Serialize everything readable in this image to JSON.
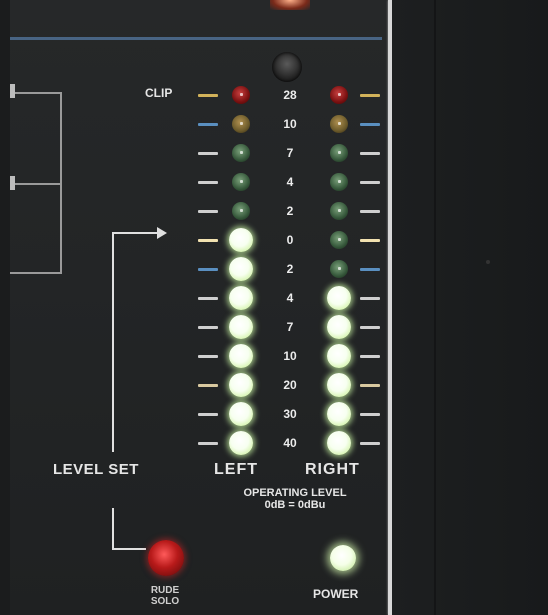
{
  "meter": {
    "clip_label": "CLIP",
    "scale": [
      "28",
      "10",
      "7",
      "4",
      "2",
      "0",
      "2",
      "4",
      "7",
      "10",
      "20",
      "30",
      "40"
    ],
    "left_leds": [
      "red-off",
      "amber-off",
      "green-off",
      "green-off",
      "green-off",
      "on",
      "on",
      "on",
      "on",
      "on",
      "on",
      "on",
      "on"
    ],
    "right_leds": [
      "red-off",
      "amber-off",
      "green-off",
      "green-off",
      "green-off",
      "green-off",
      "green-off",
      "on",
      "on",
      "on",
      "on",
      "on",
      "on"
    ],
    "tick_colors": [
      "#d2b25a",
      "#5a8fc0",
      "#cfcfcf",
      "#cfcfcf",
      "#cfcfcf",
      "#f2e2b0",
      "#5a8fc0",
      "#cfcfcf",
      "#cfcfcf",
      "#cfcfcf",
      "#d9c9a0",
      "#cfcfcf",
      "#cfcfcf"
    ]
  },
  "labels": {
    "level_set": "LEVEL SET",
    "left": "LEFT",
    "right": "RIGHT",
    "operating_level": "OPERATING LEVEL",
    "operating_level_sub": "0dB = 0dBu",
    "rude_solo_line1": "RUDE",
    "rude_solo_line2": "SOLO",
    "power": "POWER"
  },
  "colors": {
    "panel": "#232526",
    "frame_line": "#d8d8d8",
    "blue_line": "#4f6f93",
    "led_on": "#f4ffe6",
    "rude_led": "#c01f1f"
  }
}
